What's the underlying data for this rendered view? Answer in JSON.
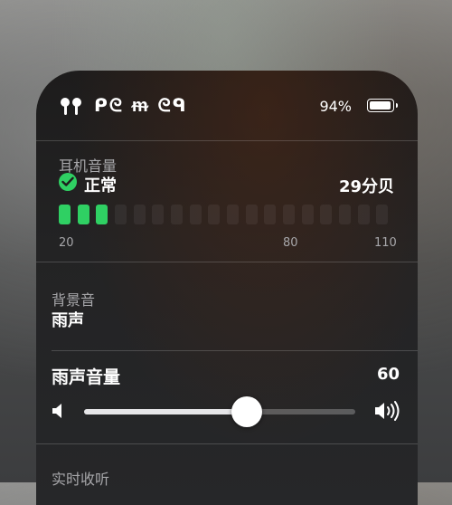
{
  "header": {
    "device_icon": "airpods-icon",
    "device_name": "ᑭᘓ ᵯ ᘓᑫ",
    "battery_percent": "94%",
    "battery_level": 0.94
  },
  "headphone_audio": {
    "label": "耳机音量",
    "status": "正常",
    "status_icon": "checkmark-circle-icon",
    "level_text": "29分贝",
    "segments_total": 18,
    "segments_on": 3,
    "scale_ticks": [
      "20",
      "80",
      "110"
    ],
    "accent_color": "#2fd063"
  },
  "background_sounds": {
    "label": "背景音",
    "value": "雨声"
  },
  "rain_volume": {
    "label": "雨声音量",
    "value": "60",
    "level": 0.6,
    "low_icon": "speaker-low-icon",
    "high_icon": "speaker-high-icon"
  },
  "live_listen": {
    "label": "实时收听"
  }
}
